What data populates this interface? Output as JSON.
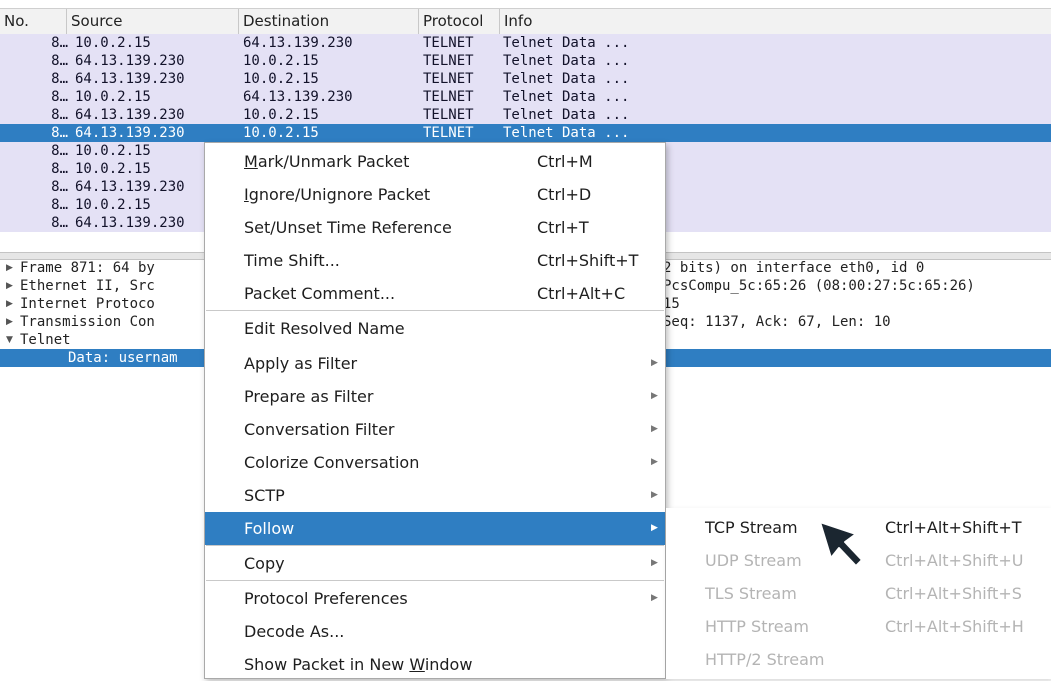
{
  "packet_list": {
    "columns": [
      "No.",
      "Source",
      "Destination",
      "Protocol",
      "Info"
    ],
    "rows": [
      {
        "no": "8…",
        "src": "10.0.2.15",
        "dst": "64.13.139.230",
        "proto": "TELNET",
        "info": "Telnet Data ..."
      },
      {
        "no": "8…",
        "src": "64.13.139.230",
        "dst": "10.0.2.15",
        "proto": "TELNET",
        "info": "Telnet Data ..."
      },
      {
        "no": "8…",
        "src": "64.13.139.230",
        "dst": "10.0.2.15",
        "proto": "TELNET",
        "info": "Telnet Data ..."
      },
      {
        "no": "8…",
        "src": "10.0.2.15",
        "dst": "64.13.139.230",
        "proto": "TELNET",
        "info": "Telnet Data ..."
      },
      {
        "no": "8…",
        "src": "64.13.139.230",
        "dst": "10.0.2.15",
        "proto": "TELNET",
        "info": "Telnet Data ..."
      },
      {
        "no": "8…",
        "src": "64.13.139.230",
        "dst": "10.0.2.15",
        "proto": "TELNET",
        "info": "Telnet Data ...",
        "selected": true
      },
      {
        "no": "8…",
        "src": "10.0.2.15",
        "dst": "",
        "proto": "",
        "info": ""
      },
      {
        "no": "8…",
        "src": "10.0.2.15",
        "dst": "",
        "proto": "",
        "info": ""
      },
      {
        "no": "8…",
        "src": "64.13.139.230",
        "dst": "",
        "proto": "",
        "info": ""
      },
      {
        "no": "8…",
        "src": "10.0.2.15",
        "dst": "",
        "proto": "",
        "info": ""
      },
      {
        "no": "8…",
        "src": "64.13.139.230",
        "dst": "",
        "proto": "",
        "info": ""
      }
    ]
  },
  "details": [
    {
      "arrow": "▶",
      "left": "Frame 871: 64 by",
      "right": "2 bits) on interface eth0, id 0"
    },
    {
      "arrow": "▶",
      "left": "Ethernet II, Src",
      "right": "PcsCompu_5c:65:26 (08:00:27:5c:65:26)"
    },
    {
      "arrow": "▶",
      "left": "Internet Protoco",
      "right": "15"
    },
    {
      "arrow": "▶",
      "left": "Transmission Con",
      "right": "Seq: 1137, Ack: 67, Len: 10"
    },
    {
      "arrow": "▼",
      "left": "Telnet",
      "right": ""
    },
    {
      "arrow": "",
      "left": "Data: usernam",
      "right": "",
      "child": true,
      "selected": true
    }
  ],
  "context_menu": {
    "items": [
      {
        "pre": "",
        "ul": "M",
        "post": "ark/Unmark Packet",
        "shortcut": "Ctrl+M"
      },
      {
        "pre": "",
        "ul": "I",
        "post": "gnore/Unignore Packet",
        "shortcut": "Ctrl+D"
      },
      {
        "pre": "Set/Unset Time Reference",
        "ul": "",
        "post": "",
        "shortcut": "Ctrl+T"
      },
      {
        "pre": "Time Shift...",
        "ul": "",
        "post": "",
        "shortcut": "Ctrl+Shift+T"
      },
      {
        "pre": "Packet Comment...",
        "ul": "",
        "post": "",
        "shortcut": "Ctrl+Alt+C"
      },
      {
        "pre": "Edit Resolved Name",
        "ul": "",
        "post": "",
        "shortcut": ""
      },
      {
        "pre": "Apply as Filter",
        "ul": "",
        "post": "",
        "shortcut": "",
        "submenu": true
      },
      {
        "pre": "Prepare as Filter",
        "ul": "",
        "post": "",
        "shortcut": "",
        "submenu": true
      },
      {
        "pre": "Conversation Filter",
        "ul": "",
        "post": "",
        "shortcut": "",
        "submenu": true
      },
      {
        "pre": "Colorize Conversation",
        "ul": "",
        "post": "",
        "shortcut": "",
        "submenu": true
      },
      {
        "pre": "SCTP",
        "ul": "",
        "post": "",
        "shortcut": "",
        "submenu": true
      },
      {
        "pre": "Follow",
        "ul": "",
        "post": "",
        "shortcut": "",
        "submenu": true,
        "active": true
      },
      {
        "pre": "Copy",
        "ul": "",
        "post": "",
        "shortcut": "",
        "submenu": true
      },
      {
        "pre": "Protocol Preferences",
        "ul": "",
        "post": "",
        "shortcut": "",
        "submenu": true
      },
      {
        "pre": "Decode As...",
        "ul": "",
        "post": "",
        "shortcut": ""
      },
      {
        "pre": "Show Packet in New ",
        "ul": "W",
        "post": "indow",
        "shortcut": ""
      }
    ]
  },
  "follow_submenu": {
    "items": [
      {
        "label": "TCP Stream",
        "shortcut": "Ctrl+Alt+Shift+T",
        "enabled": true
      },
      {
        "label": "UDP Stream",
        "shortcut": "Ctrl+Alt+Shift+U",
        "enabled": false
      },
      {
        "label": "TLS Stream",
        "shortcut": "Ctrl+Alt+Shift+S",
        "enabled": false
      },
      {
        "label": "HTTP Stream",
        "shortcut": "Ctrl+Alt+Shift+H",
        "enabled": false
      },
      {
        "label": "HTTP/2 Stream",
        "shortcut": "",
        "enabled": false
      }
    ]
  },
  "icons": {
    "submenu_arrow": "triangle-right-icon",
    "expand_arrow": "expand-triangle-icon",
    "cursor": "mouse-pointer-icon"
  },
  "colors": {
    "selection": "#2f7ec2",
    "row_background": "#e4e1f5",
    "disabled_text": "#b4b4b4"
  }
}
